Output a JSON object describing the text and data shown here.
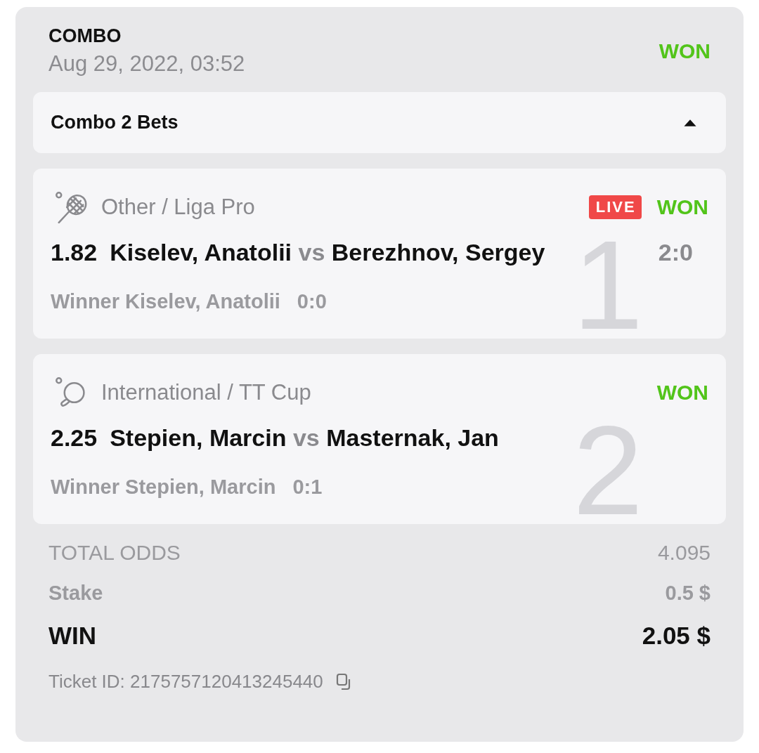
{
  "bet": {
    "type": "COMBO",
    "date": "Aug 29, 2022, 03:52",
    "status": "WON"
  },
  "combo_toggle": {
    "label": "Combo 2 Bets",
    "expanded": true
  },
  "legs": [
    {
      "index": "1",
      "kind": "tennis",
      "category": "Other / Liga Pro",
      "live": true,
      "live_label": "LIVE",
      "status": "WON",
      "odds": "1.82",
      "home": "Kiselev, Anatolii",
      "vs": "vs",
      "away": "Berezhnov, Sergey",
      "score": "2:0",
      "selection": "Winner Kiselev, Anatolii",
      "selection_score": "0:0"
    },
    {
      "index": "2",
      "kind": "table-tennis",
      "category": "International / TT Cup",
      "live": false,
      "status": "WON",
      "odds": "2.25",
      "home": "Stepien, Marcin",
      "vs": "vs",
      "away": "Masternak, Jan",
      "selection": "Winner Stepien, Marcin",
      "selection_score": "0:1"
    }
  ],
  "summary": {
    "total_odds_label": "TOTAL ODDS",
    "total_odds": "4.095",
    "stake_label": "Stake",
    "stake": "0.5 $",
    "win_label": "WIN",
    "win": "2.05 $",
    "ticket_id": "Ticket ID: 2175757120413245440"
  }
}
